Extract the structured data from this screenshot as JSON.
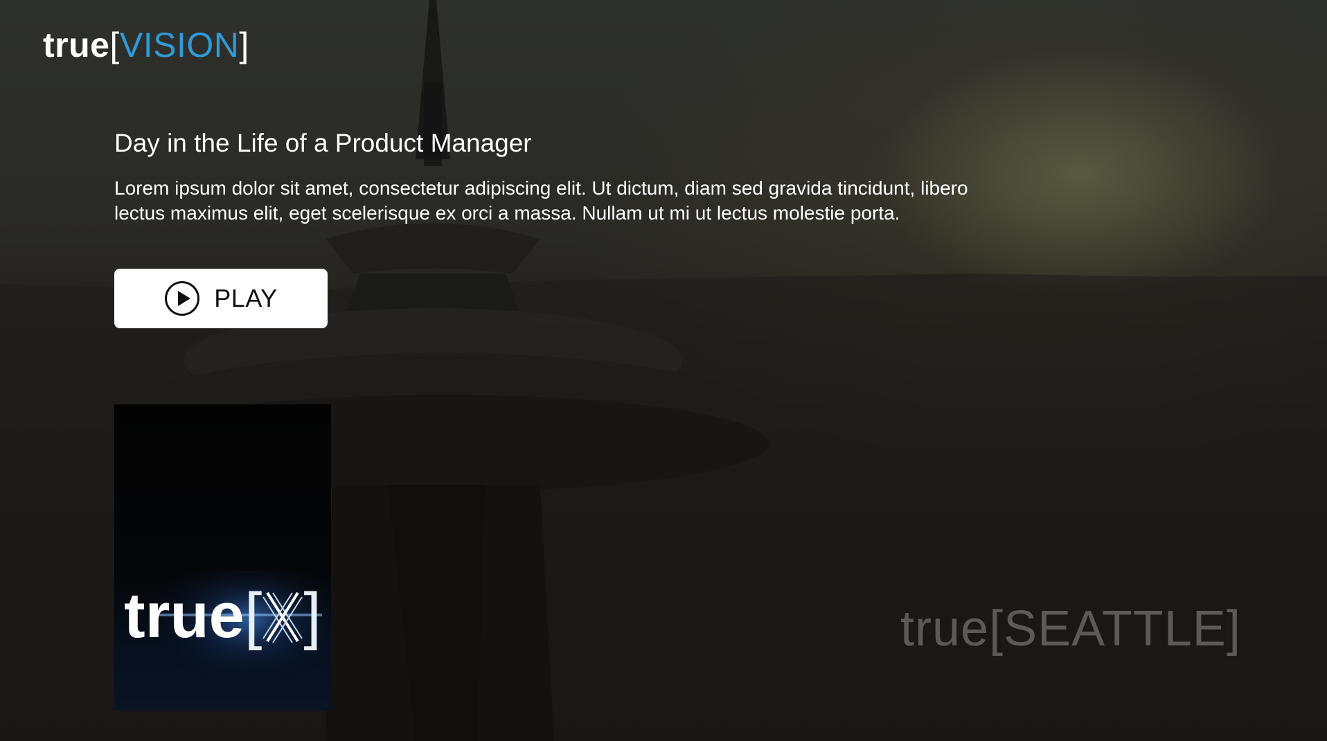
{
  "app": {
    "logo": {
      "word": "true",
      "bracket_open": "[",
      "accent": "VISION",
      "bracket_close": "]"
    }
  },
  "feature": {
    "title": "Day in the Life of a Product Manager",
    "description": "Lorem ipsum dolor sit amet, consectetur adipiscing elit. Ut dictum, diam sed gravida tincidunt, libero lectus maximus elit, eget scelerisque ex orci a massa. Nullam ut mi ut lectus molestie porta.",
    "play_button": {
      "label": "PLAY",
      "icon": "play-circle-icon"
    }
  },
  "poster": {
    "logo_word": "true",
    "bracket_open": "[",
    "bracket_close": "]",
    "icon": "x-mark-icon"
  },
  "watermark": {
    "text": "true[SEATTLE]"
  },
  "colors": {
    "accent": "#2f9ad6",
    "button_bg": "#ffffff",
    "text": "#ffffff"
  }
}
